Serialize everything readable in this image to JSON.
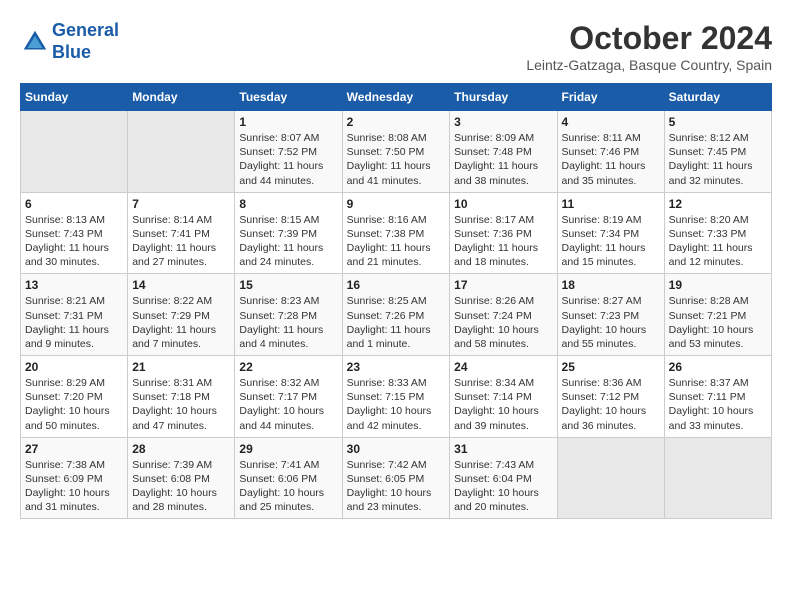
{
  "header": {
    "logo_line1": "General",
    "logo_line2": "Blue",
    "month_title": "October 2024",
    "location": "Leintz-Gatzaga, Basque Country, Spain"
  },
  "weekdays": [
    "Sunday",
    "Monday",
    "Tuesday",
    "Wednesday",
    "Thursday",
    "Friday",
    "Saturday"
  ],
  "weeks": [
    [
      {
        "day": "",
        "info": ""
      },
      {
        "day": "",
        "info": ""
      },
      {
        "day": "1",
        "info": "Sunrise: 8:07 AM\nSunset: 7:52 PM\nDaylight: 11 hours and 44 minutes."
      },
      {
        "day": "2",
        "info": "Sunrise: 8:08 AM\nSunset: 7:50 PM\nDaylight: 11 hours and 41 minutes."
      },
      {
        "day": "3",
        "info": "Sunrise: 8:09 AM\nSunset: 7:48 PM\nDaylight: 11 hours and 38 minutes."
      },
      {
        "day": "4",
        "info": "Sunrise: 8:11 AM\nSunset: 7:46 PM\nDaylight: 11 hours and 35 minutes."
      },
      {
        "day": "5",
        "info": "Sunrise: 8:12 AM\nSunset: 7:45 PM\nDaylight: 11 hours and 32 minutes."
      }
    ],
    [
      {
        "day": "6",
        "info": "Sunrise: 8:13 AM\nSunset: 7:43 PM\nDaylight: 11 hours and 30 minutes."
      },
      {
        "day": "7",
        "info": "Sunrise: 8:14 AM\nSunset: 7:41 PM\nDaylight: 11 hours and 27 minutes."
      },
      {
        "day": "8",
        "info": "Sunrise: 8:15 AM\nSunset: 7:39 PM\nDaylight: 11 hours and 24 minutes."
      },
      {
        "day": "9",
        "info": "Sunrise: 8:16 AM\nSunset: 7:38 PM\nDaylight: 11 hours and 21 minutes."
      },
      {
        "day": "10",
        "info": "Sunrise: 8:17 AM\nSunset: 7:36 PM\nDaylight: 11 hours and 18 minutes."
      },
      {
        "day": "11",
        "info": "Sunrise: 8:19 AM\nSunset: 7:34 PM\nDaylight: 11 hours and 15 minutes."
      },
      {
        "day": "12",
        "info": "Sunrise: 8:20 AM\nSunset: 7:33 PM\nDaylight: 11 hours and 12 minutes."
      }
    ],
    [
      {
        "day": "13",
        "info": "Sunrise: 8:21 AM\nSunset: 7:31 PM\nDaylight: 11 hours and 9 minutes."
      },
      {
        "day": "14",
        "info": "Sunrise: 8:22 AM\nSunset: 7:29 PM\nDaylight: 11 hours and 7 minutes."
      },
      {
        "day": "15",
        "info": "Sunrise: 8:23 AM\nSunset: 7:28 PM\nDaylight: 11 hours and 4 minutes."
      },
      {
        "day": "16",
        "info": "Sunrise: 8:25 AM\nSunset: 7:26 PM\nDaylight: 11 hours and 1 minute."
      },
      {
        "day": "17",
        "info": "Sunrise: 8:26 AM\nSunset: 7:24 PM\nDaylight: 10 hours and 58 minutes."
      },
      {
        "day": "18",
        "info": "Sunrise: 8:27 AM\nSunset: 7:23 PM\nDaylight: 10 hours and 55 minutes."
      },
      {
        "day": "19",
        "info": "Sunrise: 8:28 AM\nSunset: 7:21 PM\nDaylight: 10 hours and 53 minutes."
      }
    ],
    [
      {
        "day": "20",
        "info": "Sunrise: 8:29 AM\nSunset: 7:20 PM\nDaylight: 10 hours and 50 minutes."
      },
      {
        "day": "21",
        "info": "Sunrise: 8:31 AM\nSunset: 7:18 PM\nDaylight: 10 hours and 47 minutes."
      },
      {
        "day": "22",
        "info": "Sunrise: 8:32 AM\nSunset: 7:17 PM\nDaylight: 10 hours and 44 minutes."
      },
      {
        "day": "23",
        "info": "Sunrise: 8:33 AM\nSunset: 7:15 PM\nDaylight: 10 hours and 42 minutes."
      },
      {
        "day": "24",
        "info": "Sunrise: 8:34 AM\nSunset: 7:14 PM\nDaylight: 10 hours and 39 minutes."
      },
      {
        "day": "25",
        "info": "Sunrise: 8:36 AM\nSunset: 7:12 PM\nDaylight: 10 hours and 36 minutes."
      },
      {
        "day": "26",
        "info": "Sunrise: 8:37 AM\nSunset: 7:11 PM\nDaylight: 10 hours and 33 minutes."
      }
    ],
    [
      {
        "day": "27",
        "info": "Sunrise: 7:38 AM\nSunset: 6:09 PM\nDaylight: 10 hours and 31 minutes."
      },
      {
        "day": "28",
        "info": "Sunrise: 7:39 AM\nSunset: 6:08 PM\nDaylight: 10 hours and 28 minutes."
      },
      {
        "day": "29",
        "info": "Sunrise: 7:41 AM\nSunset: 6:06 PM\nDaylight: 10 hours and 25 minutes."
      },
      {
        "day": "30",
        "info": "Sunrise: 7:42 AM\nSunset: 6:05 PM\nDaylight: 10 hours and 23 minutes."
      },
      {
        "day": "31",
        "info": "Sunrise: 7:43 AM\nSunset: 6:04 PM\nDaylight: 10 hours and 20 minutes."
      },
      {
        "day": "",
        "info": ""
      },
      {
        "day": "",
        "info": ""
      }
    ]
  ]
}
